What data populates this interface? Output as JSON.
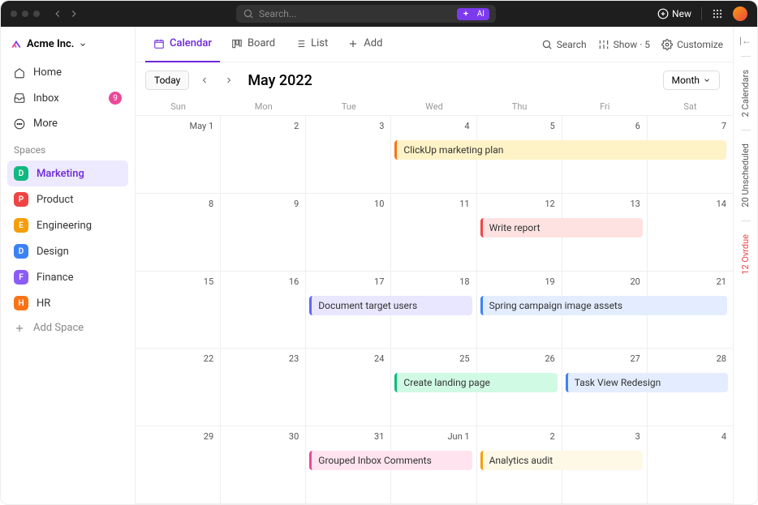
{
  "topbar": {
    "search_placeholder": "Search...",
    "ai_label": "AI",
    "new_label": "New"
  },
  "org": {
    "name": "Acme Inc."
  },
  "nav": {
    "home": "Home",
    "inbox": "Inbox",
    "inbox_badge": "9",
    "more": "More"
  },
  "spaces_section": "Spaces",
  "spaces": [
    {
      "letter": "D",
      "label": "Marketing",
      "color": "#10b981",
      "active": true
    },
    {
      "letter": "P",
      "label": "Product",
      "color": "#ef4444"
    },
    {
      "letter": "E",
      "label": "Engineering",
      "color": "#f59e0b"
    },
    {
      "letter": "D",
      "label": "Design",
      "color": "#3b82f6"
    },
    {
      "letter": "F",
      "label": "Finance",
      "color": "#8b5cf6"
    },
    {
      "letter": "H",
      "label": "HR",
      "color": "#f97316"
    }
  ],
  "add_space": "Add Space",
  "views": {
    "calendar": "Calendar",
    "board": "Board",
    "list": "List",
    "add": "Add",
    "search": "Search",
    "show": "Show · 5",
    "customize": "Customize"
  },
  "cal": {
    "today": "Today",
    "title": "May 2022",
    "range": "Month",
    "day_names": [
      "Sun",
      "Mon",
      "Tue",
      "Wed",
      "Thu",
      "Fri",
      "Sat"
    ],
    "cells": [
      "May 1",
      "2",
      "3",
      "4",
      "5",
      "6",
      "7",
      "8",
      "9",
      "10",
      "11",
      "12",
      "13",
      "14",
      "15",
      "16",
      "17",
      "18",
      "19",
      "20",
      "21",
      "22",
      "23",
      "24",
      "25",
      "26",
      "27",
      "28",
      "29",
      "30",
      "31",
      "Jun 1",
      "2",
      "3",
      "4"
    ]
  },
  "events": [
    {
      "label": "ClickUp marketing plan",
      "row": 0,
      "start": 3,
      "span": 4,
      "bg": "#fef3c7",
      "border": "#f97316"
    },
    {
      "label": "Write report",
      "row": 1,
      "start": 4,
      "span": 2,
      "bg": "#fee2e2",
      "border": "#ef4444"
    },
    {
      "label": "Document target users",
      "row": 2,
      "start": 2,
      "span": 2,
      "bg": "#e9e6ff",
      "border": "#6366f1"
    },
    {
      "label": "Spring campaign image assets",
      "row": 2,
      "start": 4,
      "span": 3,
      "bg": "#e3edff",
      "border": "#3b82f6"
    },
    {
      "label": "Create landing page",
      "row": 3,
      "start": 3,
      "span": 2,
      "bg": "#d1fae5",
      "border": "#10b981"
    },
    {
      "label": "Task View Redesign",
      "row": 3,
      "start": 5,
      "span": 2,
      "bg": "#e3edff",
      "border": "#3b82f6"
    },
    {
      "label": "Grouped Inbox Comments",
      "row": 4,
      "start": 2,
      "span": 2,
      "bg": "#ffe4ef",
      "border": "#ec4899"
    },
    {
      "label": "Analytics audit",
      "row": 4,
      "start": 4,
      "span": 2,
      "bg": "#fef9e7",
      "border": "#f59e0b"
    }
  ],
  "rail": {
    "calendars": "2 Calendars",
    "unscheduled": "20 Unscheduled",
    "overdue": "12 Ovrdue"
  }
}
